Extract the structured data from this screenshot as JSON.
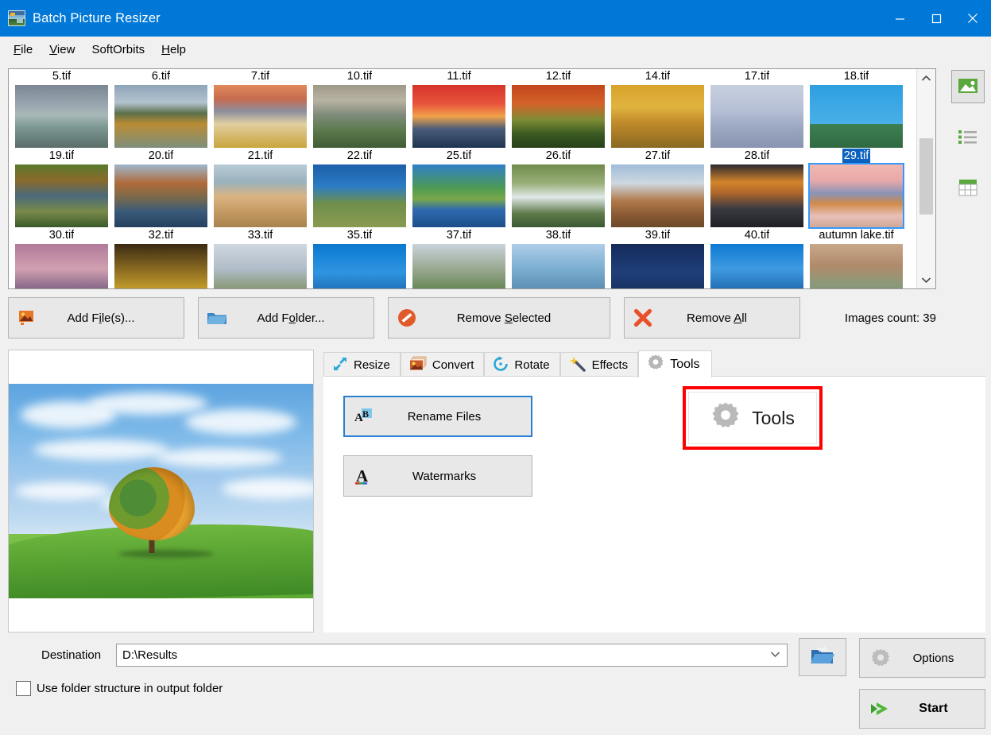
{
  "window": {
    "title": "Batch Picture Resizer",
    "icon": "app-picture-icon",
    "controls": {
      "minimize": "minimize-icon",
      "maximize": "maximize-icon",
      "close": "close-icon"
    },
    "accent_color": "#0078d7"
  },
  "menu": [
    {
      "label": "File",
      "accel": "F"
    },
    {
      "label": "View",
      "accel": "V"
    },
    {
      "label": "SoftOrbits",
      "accel": ""
    },
    {
      "label": "Help",
      "accel": "H"
    }
  ],
  "thumbnails": {
    "rows": [
      {
        "labels": [
          "5.tif",
          "6.tif",
          "7.tif",
          "10.tif",
          "11.tif",
          "12.tif",
          "14.tif",
          "17.tif",
          "18.tif"
        ]
      },
      {
        "labels": [
          "19.tif",
          "20.tif",
          "21.tif",
          "22.tif",
          "25.tif",
          "26.tif",
          "27.tif",
          "28.tif",
          "29.tif"
        ]
      },
      {
        "labels": [
          "30.tif",
          "32.tif",
          "33.tif",
          "35.tif",
          "37.tif",
          "38.tif",
          "39.tif",
          "40.tif",
          "autumn lake.tif"
        ]
      }
    ],
    "selected": "29.tif",
    "selection_color": "#0a61c0",
    "scrollbar": {
      "up": "chevron-up-icon",
      "down": "chevron-down-icon"
    }
  },
  "view_modes": [
    {
      "name": "thumbnails-view",
      "icon": "picture-icon",
      "active": true
    },
    {
      "name": "list-view",
      "icon": "list-icon",
      "active": false
    },
    {
      "name": "details-view",
      "icon": "table-icon",
      "active": false
    }
  ],
  "actions": {
    "add_files": {
      "label_pre": "Add F",
      "accel": "i",
      "label_post": "le(s)...",
      "icon": "picture-add-icon"
    },
    "add_folder": {
      "label_pre": "Add F",
      "accel": "o",
      "label_post": "lder...",
      "icon": "folder-icon"
    },
    "remove_selected": {
      "label_pre": "Remove ",
      "accel": "S",
      "label_post": "elected",
      "icon": "forbidden-icon"
    },
    "remove_all": {
      "label_pre": "Remove ",
      "accel": "A",
      "label_post": "ll",
      "icon": "red-x-icon"
    },
    "images_count": "Images count: 39"
  },
  "tabs": [
    {
      "label": "Resize",
      "icon": "resize-arrow-icon",
      "active": false
    },
    {
      "label": "Convert",
      "icon": "convert-images-icon",
      "active": false
    },
    {
      "label": "Rotate",
      "icon": "rotate-icon",
      "active": false
    },
    {
      "label": "Effects",
      "icon": "magic-wand-icon",
      "active": false
    },
    {
      "label": "Tools",
      "icon": "gear-icon",
      "active": true
    }
  ],
  "tools_panel": {
    "rename_files": {
      "label": "Rename Files",
      "icon": "ab-rename-icon",
      "focused": true
    },
    "watermarks": {
      "label": "Watermarks",
      "icon": "letter-a-icon",
      "focused": false
    },
    "tools_button": {
      "label": "Tools",
      "icon": "gear-icon"
    },
    "highlight_color": "#ff0000"
  },
  "preview": {
    "name": "selected-image-preview",
    "alt": "Lone autumn tree on a green hill under a blue cloudy sky"
  },
  "destination": {
    "label": "Destination",
    "value": "D:\\Results",
    "placeholder": "D:\\Results",
    "chevron": "chevron-down-icon",
    "browse_icon": "open-folder-icon"
  },
  "folder_structure": {
    "label": "Use folder structure in output folder",
    "checked": false
  },
  "buttons": {
    "options": {
      "label": "Options",
      "icon": "gear-icon"
    },
    "start": {
      "label": "Start",
      "icon": "green-arrow-icon"
    }
  }
}
